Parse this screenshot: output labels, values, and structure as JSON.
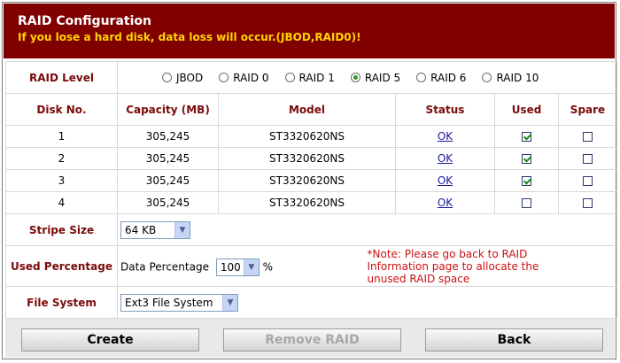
{
  "header": {
    "title": "RAID Configuration",
    "warning": "If you lose a hard disk, data loss will occur.(JBOD,RAID0)!",
    "bg_color": "#800000",
    "warning_color": "#ffd400"
  },
  "raid_level": {
    "label": "RAID Level",
    "options": [
      "JBOD",
      "RAID 0",
      "RAID 1",
      "RAID 5",
      "RAID 6",
      "RAID 10"
    ],
    "selected": "RAID 5"
  },
  "disk_table": {
    "headers": [
      "Disk No.",
      "Capacity (MB)",
      "Model",
      "Status",
      "Used",
      "Spare"
    ],
    "rows": [
      {
        "no": "1",
        "capacity": "305,245",
        "model": "ST3320620NS",
        "status": "OK",
        "used": true,
        "spare": false
      },
      {
        "no": "2",
        "capacity": "305,245",
        "model": "ST3320620NS",
        "status": "OK",
        "used": true,
        "spare": false
      },
      {
        "no": "3",
        "capacity": "305,245",
        "model": "ST3320620NS",
        "status": "OK",
        "used": true,
        "spare": false
      },
      {
        "no": "4",
        "capacity": "305,245",
        "model": "ST3320620NS",
        "status": "OK",
        "used": false,
        "spare": false
      }
    ]
  },
  "stripe_size": {
    "label": "Stripe Size",
    "value": "64 KB"
  },
  "used_percentage": {
    "label": "Used Percentage",
    "field_label": "Data Percentage",
    "value": "100",
    "unit": "%",
    "note": "*Note: Please go back to RAID Information page to allocate the unused RAID space"
  },
  "file_system": {
    "label": "File System",
    "value": "Ext3 File System"
  },
  "buttons": {
    "create": "Create",
    "remove": "Remove RAID",
    "back": "Back"
  }
}
